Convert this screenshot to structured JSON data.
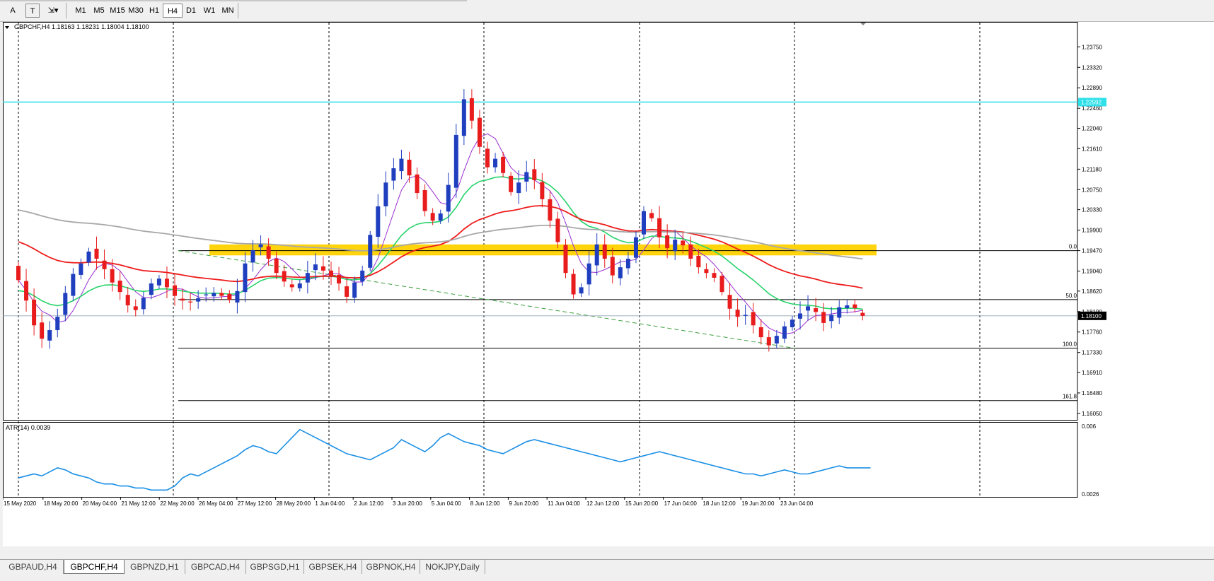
{
  "toolbar": {
    "tools": [
      {
        "label": "A",
        "icon": "text-tool-icon"
      },
      {
        "label": "T",
        "icon": "text-label-tool-icon"
      },
      {
        "label": "⇲▾",
        "icon": "arrows-tool-icon"
      }
    ],
    "timeframes": [
      "M1",
      "M5",
      "M15",
      "M30",
      "H1",
      "H4",
      "D1",
      "W1",
      "MN"
    ],
    "active_timeframe": "H4"
  },
  "chart": {
    "symbol_header": "GBPCHF,H4  1.18163 1.18231 1.18004 1.18100",
    "indicator_label": "ATR(14) 0.0039"
  },
  "chart_data": {
    "type": "candlestick",
    "symbol": "GBPCHF",
    "timeframe": "H4",
    "ohlc": {
      "open": 1.18163,
      "high": 1.18231,
      "low": 1.18004,
      "close": 1.181
    },
    "current_price_label": "1.18100",
    "cyan_line_label": "1.22592",
    "ylim": [
      1.159,
      1.242
    ],
    "y_ticks": [
      "1.23750",
      "1.23320",
      "1.22890",
      "1.22460",
      "1.22040",
      "1.21610",
      "1.21180",
      "1.20750",
      "1.20330",
      "1.19900",
      "1.19470",
      "1.19040",
      "1.18620",
      "1.18190",
      "1.17760",
      "1.17330",
      "1.16910",
      "1.16480",
      "1.16050"
    ],
    "x_ticks": [
      "15 May 2020",
      "18 May 20:00",
      "20 May 04:00",
      "21 May 12:00",
      "22 May 20:00",
      "26 May 04:00",
      "27 May 12:00",
      "28 May 20:00",
      "1 Jun 04:00",
      "2 Jun 12:00",
      "3 Jun 20:00",
      "5 Jun 04:00",
      "8 Jun 12:00",
      "9 Jun 20:00",
      "11 Jun 04:00",
      "12 Jun 12:00",
      "15 Jun 20:00",
      "17 Jun 04:00",
      "18 Jun 12:00",
      "19 Jun 20:00",
      "23 Jun 04:00"
    ],
    "closes": [
      1.1885,
      1.1842,
      1.179,
      1.1762,
      1.178,
      1.1808,
      1.1858,
      1.1898,
      1.192,
      1.1945,
      1.193,
      1.1908,
      1.188,
      1.186,
      1.1832,
      1.1822,
      1.1848,
      1.1878,
      1.1888,
      1.187,
      1.1852,
      1.1842,
      1.1838,
      1.1847,
      1.1855,
      1.1858,
      1.1852,
      1.1844,
      1.1862,
      1.192,
      1.1948,
      1.196,
      1.193,
      1.19,
      1.1882,
      1.187,
      1.1878,
      1.19,
      1.1918,
      1.1905,
      1.1892,
      1.1878,
      1.185,
      1.188,
      1.1905,
      1.198,
      1.204,
      1.209,
      1.212,
      1.214,
      1.2105,
      1.2068,
      1.203,
      1.201,
      1.2025,
      1.2085,
      1.219,
      1.2265,
      1.222,
      1.2165,
      1.2122,
      1.214,
      1.211,
      1.207,
      1.209,
      1.2112,
      1.2095,
      1.2055,
      1.201,
      1.1965,
      1.19,
      1.1855,
      1.187,
      1.192,
      1.196,
      1.193,
      1.1895,
      1.1912,
      1.193,
      1.1975,
      1.203,
      1.2015,
      1.1975,
      1.1952,
      1.197,
      1.1958,
      1.193,
      1.1912,
      1.19,
      1.189,
      1.186,
      1.1825,
      1.1808,
      1.1812,
      1.179,
      1.1765,
      1.1748,
      1.1768,
      1.1788,
      1.1802,
      1.1815,
      1.183,
      1.1818,
      1.1795,
      1.1812,
      1.1828,
      1.1832,
      1.1826,
      1.181
    ],
    "moving_averages": [
      {
        "color": "#9b30d0",
        "period_hint": "fast"
      },
      {
        "color": "#27d36a",
        "period_hint": "medium"
      },
      {
        "color": "#ee1c1c",
        "period_hint": "slow"
      },
      {
        "color": "#a8a8a8",
        "period_hint": "longest"
      }
    ],
    "fibonacci_levels": [
      {
        "label": "0.0",
        "price": 1.1947
      },
      {
        "label": "50.0",
        "price": 1.1844
      },
      {
        "label": "100.0",
        "price": 1.1742
      },
      {
        "label": "161.8",
        "price": 1.1632
      }
    ],
    "resistance_zone": {
      "price_high": 1.196,
      "price_low": 1.1937,
      "color": "#ffd200"
    },
    "cyan_line_price": 1.2259,
    "atr": {
      "period": 14,
      "value_label": "0.0039",
      "ylim": [
        0.0026,
        0.006
      ],
      "y_ticks": [
        "0.006",
        "0.0026"
      ],
      "values": [
        0.0034,
        0.0035,
        0.0036,
        0.0035,
        0.0037,
        0.0039,
        0.0038,
        0.0036,
        0.0035,
        0.0034,
        0.0032,
        0.0031,
        0.0031,
        0.003,
        0.003,
        0.0029,
        0.0029,
        0.0028,
        0.0028,
        0.0028,
        0.003,
        0.0034,
        0.0036,
        0.0035,
        0.0037,
        0.0039,
        0.0041,
        0.0043,
        0.0045,
        0.0048,
        0.005,
        0.0049,
        0.0047,
        0.0046,
        0.005,
        0.0054,
        0.0058,
        0.0056,
        0.0054,
        0.0052,
        0.005,
        0.0048,
        0.0046,
        0.0045,
        0.0044,
        0.0043,
        0.0045,
        0.0047,
        0.0049,
        0.0053,
        0.0051,
        0.0049,
        0.0047,
        0.005,
        0.0054,
        0.0056,
        0.0054,
        0.0052,
        0.0051,
        0.005,
        0.0048,
        0.0047,
        0.0046,
        0.0048,
        0.005,
        0.0052,
        0.0053,
        0.0052,
        0.0051,
        0.005,
        0.0049,
        0.0048,
        0.0047,
        0.0046,
        0.0045,
        0.0044,
        0.0043,
        0.0042,
        0.0043,
        0.0044,
        0.0045,
        0.0046,
        0.0047,
        0.0046,
        0.0045,
        0.0044,
        0.0043,
        0.0042,
        0.0041,
        0.004,
        0.0039,
        0.0038,
        0.0037,
        0.0036,
        0.0036,
        0.0035,
        0.0036,
        0.0037,
        0.0038,
        0.0037,
        0.0036,
        0.0036,
        0.0037,
        0.0038,
        0.0039,
        0.004,
        0.0039,
        0.0039,
        0.0039,
        0.0039
      ]
    },
    "colors": {
      "bull": "#1f3fbf",
      "bear": "#e81c1c",
      "atr_line": "#1a8fe6",
      "cyan": "#2fe0e8",
      "grid": "#000000"
    }
  },
  "tabs": {
    "items": [
      "GBPAUD,H4",
      "GBPCHF,H4",
      "GBPNZD,H1",
      "GBPCAD,H4",
      "GBPSGD,H1",
      "GBPSEK,H4",
      "GBPNOK,H4",
      "NOKJPY,Daily"
    ],
    "active": "GBPCHF,H4"
  }
}
